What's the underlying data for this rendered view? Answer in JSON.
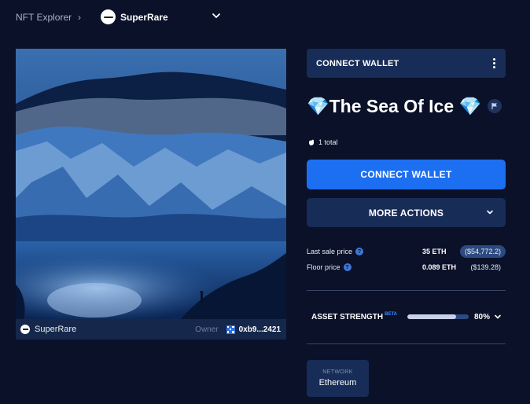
{
  "breadcrumb": {
    "root": "NFT Explorer",
    "separator": "›",
    "collection": "SuperRare"
  },
  "artwork": {
    "platform": "SuperRare",
    "owner_label": "Owner",
    "owner_address": "0xb9...2421"
  },
  "actions": {
    "wallet_bar_label": "CONNECT WALLET",
    "connect_button": "CONNECT WALLET",
    "more_actions": "MORE ACTIONS"
  },
  "asset": {
    "title": "💎The Sea Of Ice 💎",
    "total": "1 total"
  },
  "prices": {
    "last_sale_label": "Last sale price",
    "last_sale_eth": "35 ETH",
    "last_sale_usd": "($54,772.2)",
    "floor_label": "Floor price",
    "floor_eth": "0.089 ETH",
    "floor_usd": "($139.28)"
  },
  "strength": {
    "label": "ASSET STRENGTH",
    "badge": "BETA",
    "percent_text": "80%",
    "value": 0.8
  },
  "network": {
    "label": "NETWORK",
    "value": "Ethereum"
  },
  "colors": {
    "background": "#0a1128",
    "panel": "#172c57",
    "primary": "#1d6ff2"
  }
}
